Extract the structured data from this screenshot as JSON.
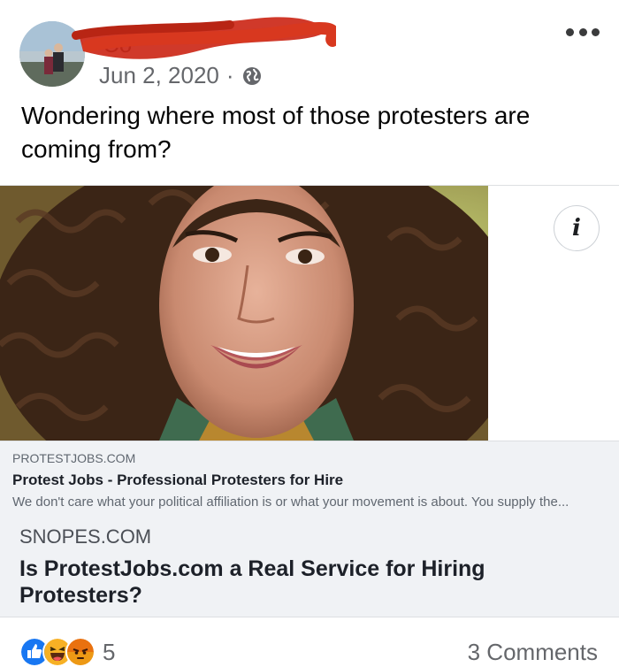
{
  "post": {
    "author_visible": "Co",
    "date": "Jun 2, 2020",
    "separator": "·",
    "privacy_icon": "globe-icon",
    "more_icon": "more-options-icon",
    "text": "Wondering where most of those protesters are coming from?"
  },
  "link_card": {
    "info_icon": "info-icon",
    "info_label": "i",
    "domain": "PROTESTJOBS.COM",
    "title": "Protest Jobs - Professional Protesters for Hire",
    "description": "We don't care what your political affiliation is or what your movement is about. You supply the..."
  },
  "fact_check_card": {
    "domain": "SNOPES.COM",
    "title": "Is ProtestJobs.com a Real Service for Hiring Protesters?"
  },
  "footer": {
    "reactions": [
      "like-icon",
      "haha-icon",
      "angry-icon"
    ],
    "reaction_count": "5",
    "comments": "3 Comments"
  },
  "colors": {
    "like_blue": "#1877f2",
    "haha_yellow": "#f7b125",
    "angry_orange": "#e9710f",
    "redaction_red": "#cc2a1a"
  }
}
